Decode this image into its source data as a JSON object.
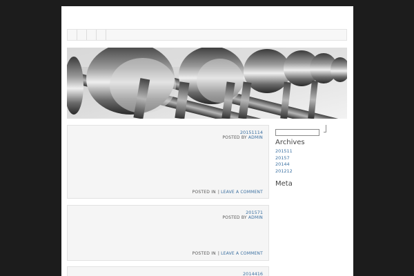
{
  "nav": {
    "item_count": 4
  },
  "posts": [
    {
      "date": "20151114",
      "posted_by": "POSTED BY",
      "author": "ADMIN",
      "posted_in": "POSTED IN",
      "separator": "|",
      "comment_link": "LEAVE A COMMENT"
    },
    {
      "date": "201571",
      "posted_by": "POSTED BY",
      "author": "ADMIN",
      "posted_in": "POSTED IN",
      "separator": "|",
      "comment_link": "LEAVE A COMMENT"
    },
    {
      "date": "2014416"
    }
  ],
  "sidebar": {
    "search": {
      "value": ""
    },
    "archives_title": "Archives",
    "archives": [
      "201511",
      "20157",
      "20144",
      "201212"
    ],
    "meta_title": "Meta"
  },
  "colors": {
    "background": "#1c1c1c",
    "link": "#3a6fa0",
    "post_bg": "#f5f5f5"
  }
}
